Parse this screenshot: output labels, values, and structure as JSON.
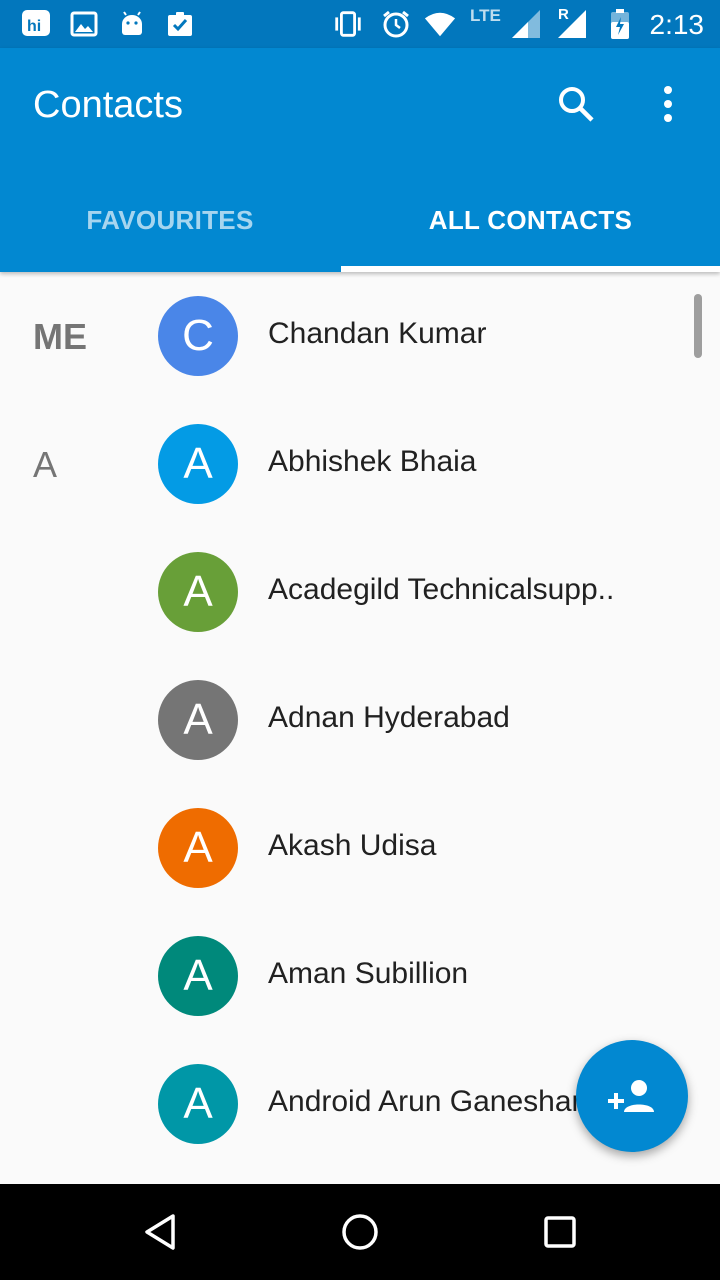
{
  "status_bar": {
    "time": "2:13",
    "network_label": "LTE",
    "roaming_label": "R",
    "icons": [
      "hike-icon",
      "gallery-icon",
      "android-icon",
      "task-icon",
      "vibrate-icon",
      "alarm-icon",
      "wifi-icon",
      "signal-icon",
      "signal-roaming-icon",
      "battery-icon"
    ]
  },
  "app_bar": {
    "title": "Contacts",
    "tabs": [
      {
        "label": "FAVOURITES",
        "selected": false
      },
      {
        "label": "ALL CONTACTS",
        "selected": true
      }
    ]
  },
  "contacts": [
    {
      "section": "ME",
      "initial": "C",
      "name": "Chandan Kumar",
      "color": "#4a86e8"
    },
    {
      "section": "A",
      "initial": "A",
      "name": "Abhishek Bhaia",
      "color": "#039be5"
    },
    {
      "section": "",
      "initial": "A",
      "name": "Acadegild Technicalsupp..",
      "color": "#689f38"
    },
    {
      "section": "",
      "initial": "A",
      "name": "Adnan Hyderabad",
      "color": "#757575"
    },
    {
      "section": "",
      "initial": "A",
      "name": "Akash Udisa",
      "color": "#ef6c00"
    },
    {
      "section": "",
      "initial": "A",
      "name": "Aman Subillion",
      "color": "#00897b"
    },
    {
      "section": "",
      "initial": "A",
      "name": "Android Arun Ganeshan",
      "color": "#0097a7"
    }
  ],
  "fab": {
    "icon": "add-person-icon"
  },
  "colors": {
    "primary": "#0288d1",
    "status_bar": "#0277bd",
    "background": "#fafafa"
  }
}
